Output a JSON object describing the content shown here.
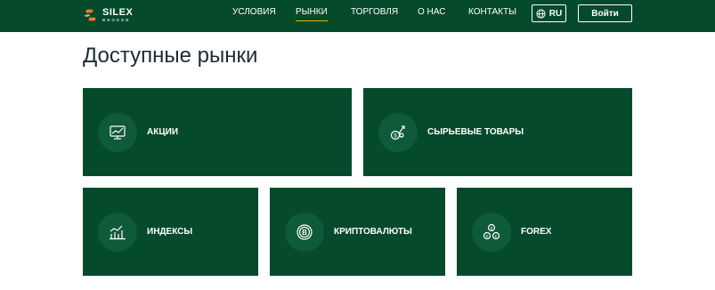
{
  "header": {
    "logo": {
      "name": "SILEX",
      "sub": "BROKER"
    },
    "nav": [
      {
        "label": "УСЛОВИЯ"
      },
      {
        "label": "РЫНКИ"
      },
      {
        "label": "ТОРГОВЛЯ"
      },
      {
        "label": "О НАС"
      },
      {
        "label": "КОНТАКТЫ"
      }
    ],
    "language": "RU",
    "login": "Войти",
    "active_nav": "РЫНКИ",
    "accent_color": "#f0b400",
    "background_color": "#064a2c"
  },
  "main": {
    "title": "Доступные рынки",
    "markets": [
      {
        "label": "АКЦИИ",
        "icon": "stock-chart-icon"
      },
      {
        "label": "СЫРЬЕВЫЕ ТОВАРЫ",
        "icon": "commodities-icon"
      },
      {
        "label": "ИНДЕКСЫ",
        "icon": "index-chart-icon"
      },
      {
        "label": "КРИПТОВАЛЮТЫ",
        "icon": "bitcoin-icon"
      },
      {
        "label": "FOREX",
        "icon": "forex-exchange-icon"
      }
    ]
  }
}
